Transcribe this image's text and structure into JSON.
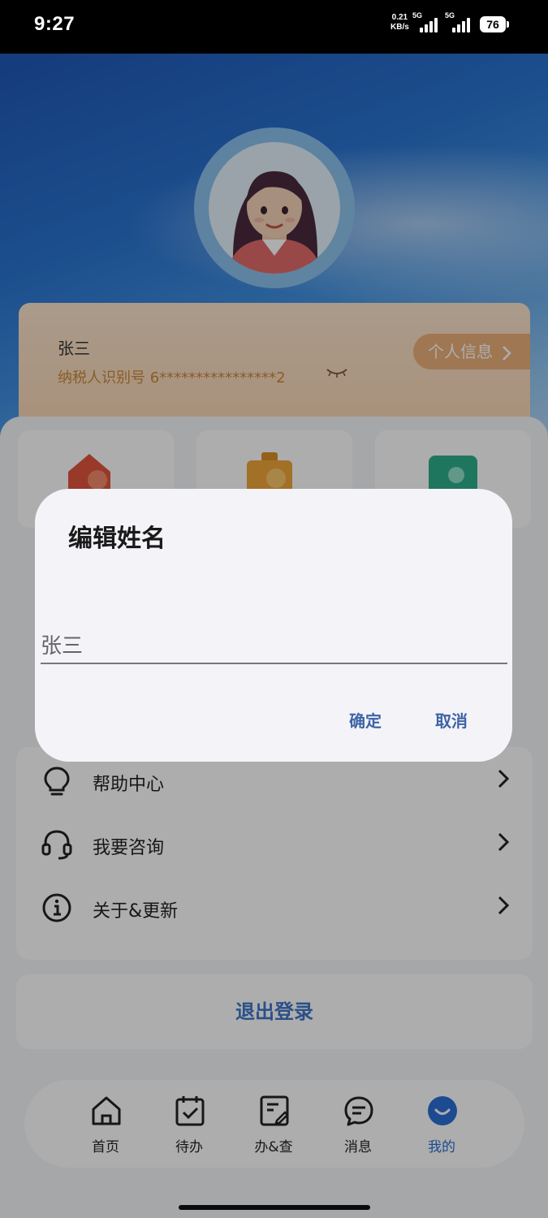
{
  "status_bar": {
    "time": "9:27",
    "net_speed_value": "0.21",
    "net_speed_unit": "KB/s",
    "sim1_type": "5G",
    "sim2_type": "5G",
    "battery": "76"
  },
  "user_card": {
    "name": "张三",
    "taxid_label": "纳税人识别号 6****************2",
    "profile_button": "个人信息"
  },
  "menu": {
    "items": [
      {
        "label": "帮助中心",
        "icon": "lightbulb-icon"
      },
      {
        "label": "我要咨询",
        "icon": "headset-icon"
      },
      {
        "label": "关于&更新",
        "icon": "info-icon"
      }
    ]
  },
  "logout_label": "退出登录",
  "tabbar": {
    "items": [
      {
        "label": "首页",
        "icon": "home-icon"
      },
      {
        "label": "待办",
        "icon": "calendar-check-icon"
      },
      {
        "label": "办&查",
        "icon": "document-edit-icon"
      },
      {
        "label": "消息",
        "icon": "chat-icon"
      },
      {
        "label": "我的",
        "icon": "smile-icon",
        "active": true
      }
    ]
  },
  "dialog": {
    "title": "编辑姓名",
    "input_value": "张三",
    "confirm_label": "确定",
    "cancel_label": "取消"
  },
  "colors": {
    "accent": "#2c6fd6",
    "dialog_button": "#3d64a6",
    "card_orange": "#f8d2ad"
  }
}
